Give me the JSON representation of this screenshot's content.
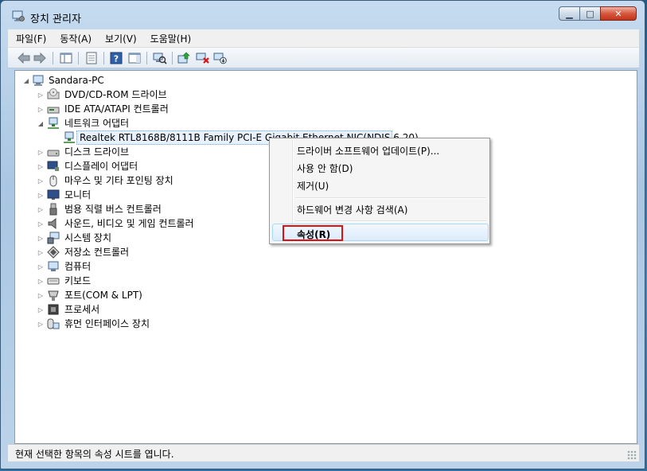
{
  "window": {
    "title": "장치 관리자"
  },
  "menu": [
    "파일(F)",
    "동작(A)",
    "보기(V)",
    "도움말(H)"
  ],
  "tree": {
    "root": "Sandara-PC",
    "items": [
      "DVD/CD-ROM 드라이브",
      "IDE ATA/ATAPI 컨트롤러",
      "네트워크 어댑터",
      "Realtek RTL8168B/8111B Family PCI-E Gigabit Ethernet NIC(NDIS 6.20)",
      "디스크 드라이브",
      "디스플레이 어댑터",
      "마우스 및 기타 포인팅 장치",
      "모니터",
      "범용 직렬 버스 컨트롤러",
      "사운드, 비디오 및 게임 컨트롤러",
      "시스템 장치",
      "저장소 컨트롤러",
      "컴퓨터",
      "키보드",
      "포트(COM & LPT)",
      "프로세서",
      "휴먼 인터페이스 장치"
    ]
  },
  "context_menu": {
    "update": "드라이버 소프트웨어 업데이트(P)...",
    "disable": "사용 안 함(D)",
    "uninstall": "제거(U)",
    "scan": "하드웨어 변경 사항 검색(A)",
    "properties": "속성(R)"
  },
  "status": "현재 선택한 항목의 속성 시트를 엽니다.",
  "colors": {
    "highlight_box": "#e20f0f",
    "selection_border": "#7da2ce"
  }
}
